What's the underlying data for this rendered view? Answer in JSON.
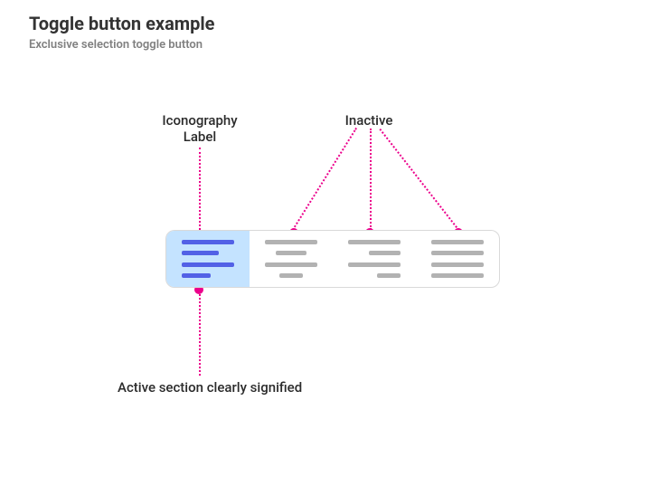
{
  "header": {
    "title": "Toggle button example",
    "subtitle": "Exclusive selection toggle button"
  },
  "annotations": {
    "iconography_label": "Iconography\nLabel",
    "inactive": "Inactive",
    "active_caption": "Active section clearly signified"
  },
  "toggle": {
    "options": [
      {
        "key": "align-left",
        "icon": "align-left-icon",
        "active": true
      },
      {
        "key": "align-center",
        "icon": "align-center-icon",
        "active": false
      },
      {
        "key": "align-right",
        "icon": "align-right-icon",
        "active": false
      },
      {
        "key": "align-justify",
        "icon": "align-justify-icon",
        "active": false
      }
    ]
  },
  "colors": {
    "accent_magenta": "#ec008c",
    "active_bg": "#c4e3ff",
    "active_icon": "#5261e6",
    "inactive_icon": "#b2b2b2",
    "border": "#d9d9d9"
  }
}
